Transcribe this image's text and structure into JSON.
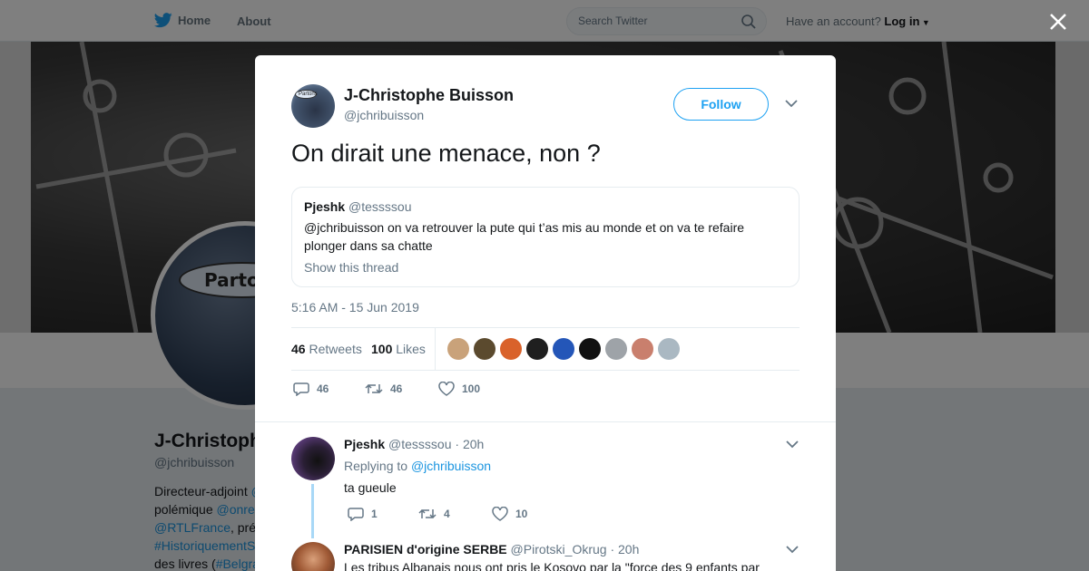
{
  "topbar": {
    "home_label": "Home",
    "about_label": "About",
    "search_placeholder": "Search Twitter",
    "account_prompt": "Have an account?",
    "login_label": "Log in"
  },
  "profile": {
    "name": "J-Christophe",
    "handle": "@jchribuisson",
    "avatar_bubble": "Partons",
    "bio_lines": [
      {
        "text": "Directeur-adjoint ",
        "link": "@"
      },
      {
        "text": "polémique ",
        "link": "@onre"
      },
      {
        "text": "",
        "link": "@RTLFrance",
        "after": ", pré"
      },
      {
        "text": "",
        "link": "#HistoriquementS"
      },
      {
        "text": "des livres (",
        "link": "#Belgra"
      }
    ]
  },
  "tweet": {
    "author_name": "J-Christophe Buisson",
    "author_handle": "@jchribuisson",
    "avatar_bubble": "Partons",
    "follow_label": "Follow",
    "text": "On dirait une menace, non ?",
    "quote": {
      "name": "Pjeshk",
      "handle": "@tessssou",
      "text": "@jchribuisson on va retrouver la pute qui t’as mis au monde et on va te refaire plonger dans sa chatte",
      "thread_link": "Show this thread"
    },
    "timestamp": "5:16 AM - 15 Jun 2019",
    "retweets_count": "46",
    "retweets_label": "Retweets",
    "likes_count": "100",
    "likes_label": "Likes",
    "liker_colors": [
      "#c9a27a",
      "#5b4a2e",
      "#d9622b",
      "#1f1f1f",
      "#2456b8",
      "#111111",
      "#9ea3a8",
      "#c97f6d",
      "#aab8c2"
    ],
    "actions": {
      "replies": "46",
      "retweets": "46",
      "likes": "100"
    }
  },
  "replies": [
    {
      "name": "Pjeshk",
      "handle": "@tessssou",
      "time": "· 20h",
      "replying_prefix": "Replying to",
      "replying_to": "@jchribuisson",
      "text": "ta gueule",
      "actions": {
        "replies": "1",
        "retweets": "4",
        "likes": "10"
      }
    },
    {
      "name": "PARISIEN d'origine SERBE",
      "handle": "@Pirotski_Okrug",
      "time": "· 20h",
      "text": "Les tribus Albanais nous ont pris le Kosovo par la \"force des 9 enfants par"
    }
  ],
  "colors": {
    "accent": "#1da1f2",
    "text": "#14171a",
    "muted": "#657786"
  }
}
